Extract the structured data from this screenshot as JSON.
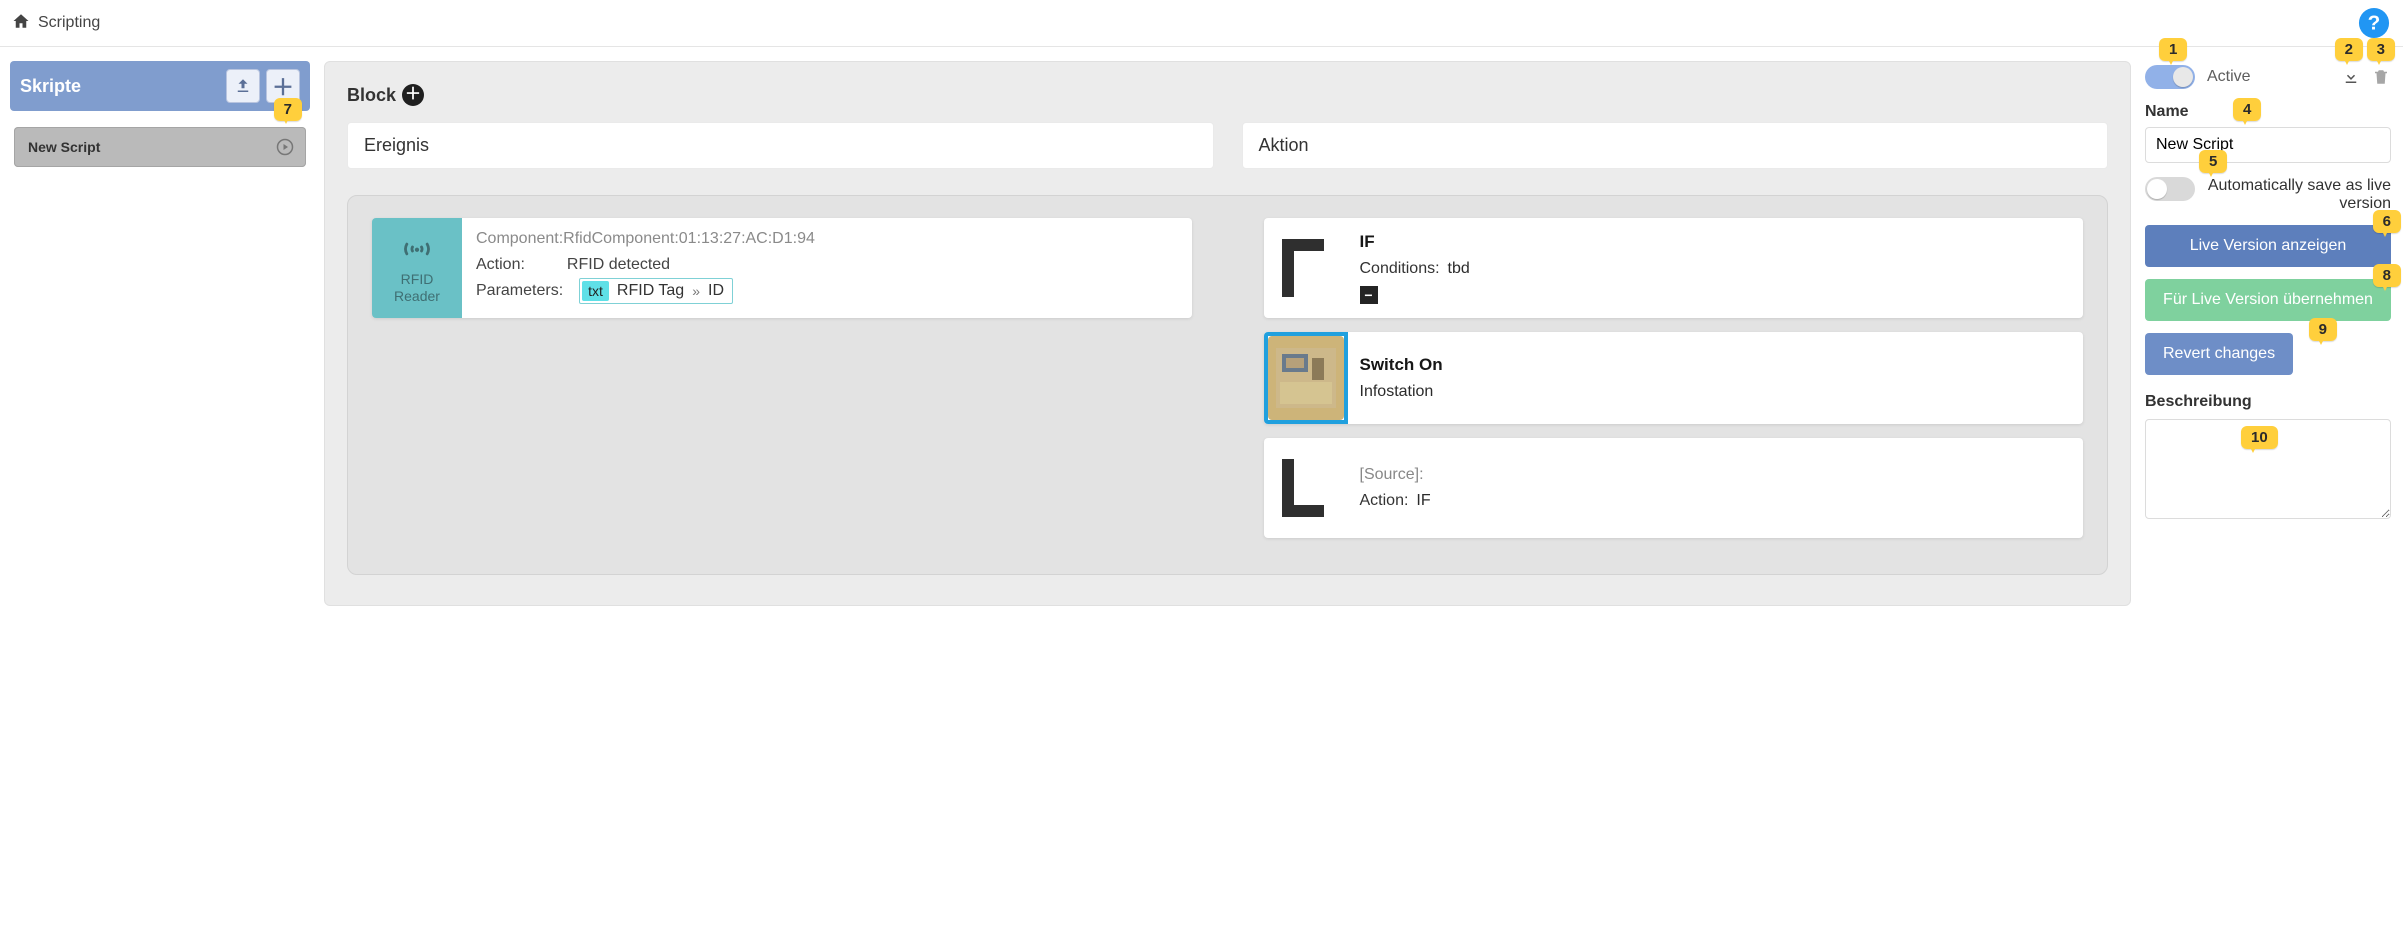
{
  "topbar": {
    "crumb": "Scripting"
  },
  "sidebar": {
    "title": "Skripte",
    "items": [
      {
        "label": "New Script"
      }
    ]
  },
  "canvas": {
    "block_label": "Block",
    "event_header": "Ereignis",
    "action_header": "Aktion",
    "event": {
      "chip_caption": "RFID Reader",
      "component_line": "Component:RfidComponent:01:13:27:AC:D1:94",
      "action_label": "Action:",
      "action_value": "RFID detected",
      "params_label": "Parameters:",
      "param_txt_badge": "txt",
      "param_text": "RFID Tag",
      "param_arrow": "»",
      "param_right": "ID"
    },
    "actions": [
      {
        "title": "IF",
        "row1_label": "Conditions:",
        "row1_value": "tbd",
        "has_minus": true,
        "thumb": "bracket-tl"
      },
      {
        "title": "Switch On",
        "row1_value": "Infostation",
        "thumb": "photo",
        "selected": true
      },
      {
        "title_gray": "[Source]:",
        "row1_label": "Action:",
        "row1_value": "IF",
        "thumb": "bracket-bl"
      }
    ]
  },
  "rightPanel": {
    "active_label": "Active",
    "name_label": "Name",
    "name_value": "New Script",
    "auto_label": "Automatically save as live version",
    "btn_live_show": "Live Version anzeigen",
    "btn_apply_live": "Für Live Version übernehmen",
    "btn_revert": "Revert changes",
    "desc_label": "Beschreibung"
  },
  "badges": {
    "b1": "1",
    "b2": "2",
    "b3": "3",
    "b4": "4",
    "b5": "5",
    "b6": "6",
    "b7": "7",
    "b8": "8",
    "b9": "9",
    "b10": "10"
  }
}
